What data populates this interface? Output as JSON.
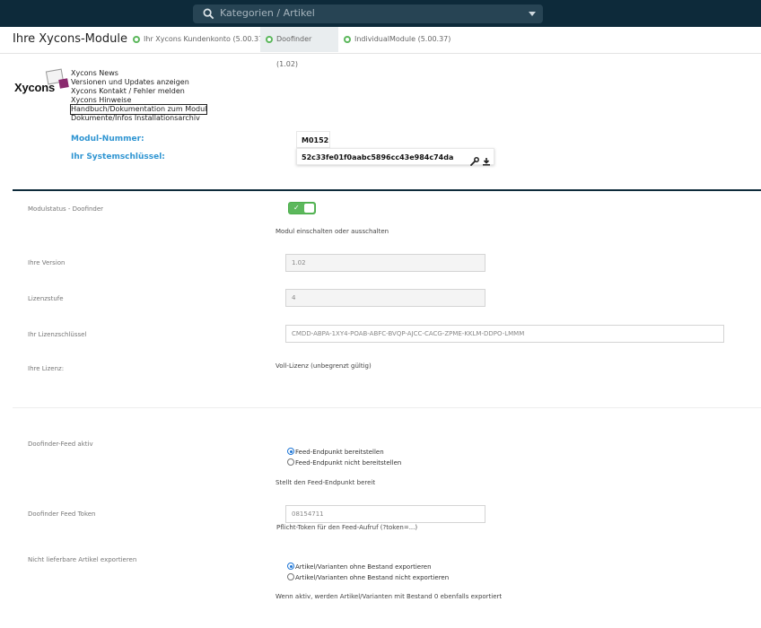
{
  "topbar": {
    "search_placeholder": "Kategorien / Artikel"
  },
  "header": {
    "title": "Ihre Xycons-Module",
    "tabs": [
      {
        "label": "Ihr Xycons Kundenkonto (5.00.37)"
      },
      {
        "label": "Doofinder (1.02)"
      },
      {
        "label": "IndividualModule (5.00.37)"
      }
    ]
  },
  "logo": {
    "brand": "Xycons"
  },
  "links": [
    "Xycons News",
    "Versionen und Updates anzeigen",
    "Xycons Kontakt / Fehler melden",
    "Xycons Hinweise",
    "Handbuch/Dokumentation zum Modul",
    "Dokumente/Infos Installationsarchiv"
  ],
  "module": {
    "number_label": "Modul-Nummer:",
    "number_value": "M0152",
    "key_label": "Ihr Systemschlüssel:",
    "key_value": "52c33fe01f0aabc5896cc43e984c74da"
  },
  "settings": {
    "status_label": "Modulstatus - Doofinder",
    "status_note": "Modul einschalten oder ausschalten",
    "status_on": true,
    "version_label": "Ihre Version",
    "version_value": "1.02",
    "level_label": "Lizenzstufe",
    "level_value": "4",
    "license_key_label": "Ihr Lizenzschlüssel",
    "license_key_value": "CMDD-ABPA-1XY4-POAB-ABFC-BVQP-AJCC-CACG-ZPME-KKLM-DDPO-LMMM",
    "license_label": "Ihre Lizenz:",
    "license_value": "Voll-Lizenz (unbegrenzt gültig)",
    "feed_label": "Doofinder-Feed aktiv",
    "feed_options": [
      "Feed-Endpunkt bereitstellen",
      "Feed-Endpunkt nicht bereitstellen"
    ],
    "feed_note": "Stellt den Feed-Endpunkt bereit",
    "token_label": "Doofinder Feed Token",
    "token_value": "08154711",
    "token_note": "Pflicht-Token für den Feed-Aufruf (?token=...)",
    "export_label": "Nicht lieferbare Artikel exportieren",
    "export_options": [
      "Artikel/Varianten ohne Bestand exportieren",
      "Artikel/Varianten ohne Bestand nicht exportieren"
    ],
    "export_note": "Wenn aktiv, werden Artikel/Varianten mit Bestand 0 ebenfalls exportiert"
  }
}
